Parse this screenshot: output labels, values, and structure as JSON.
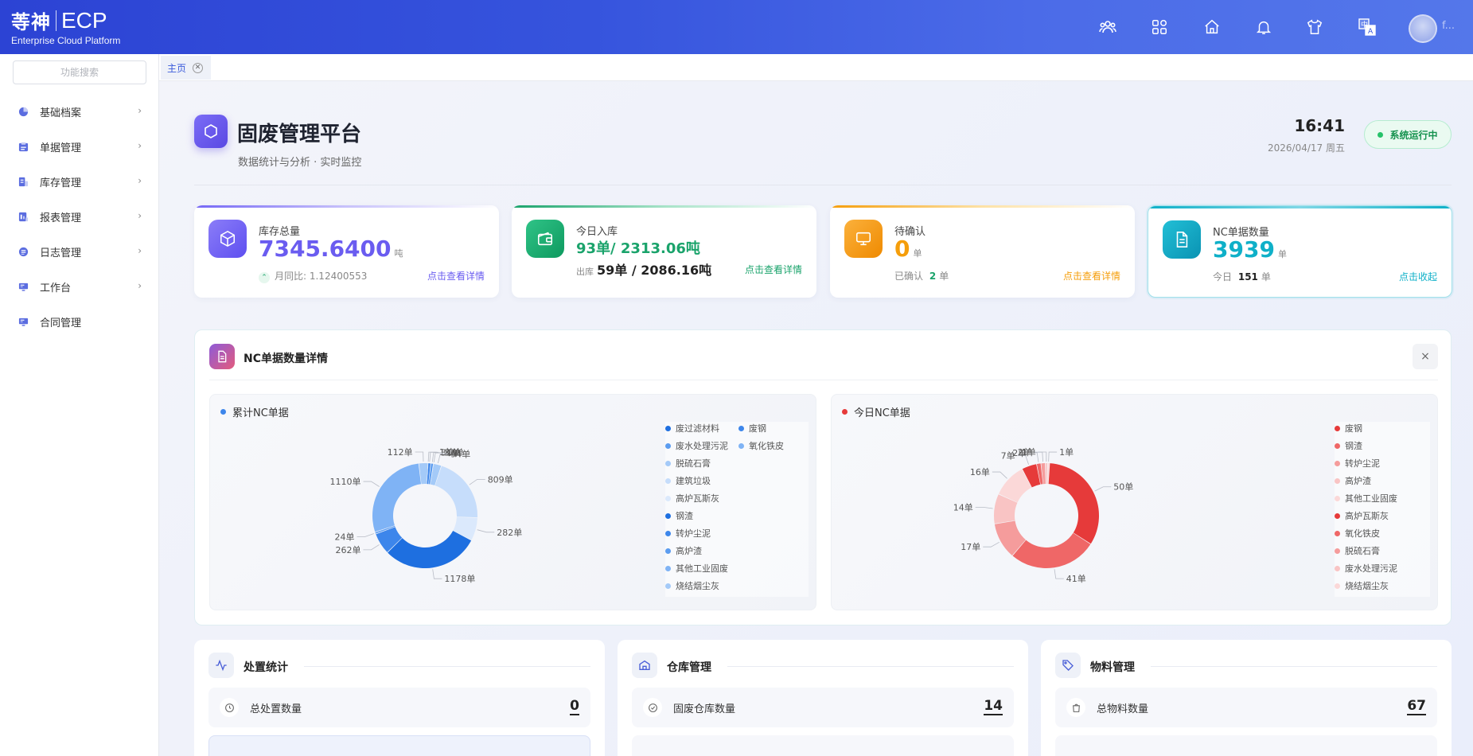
{
  "header": {
    "logo_mark": "䓁神",
    "logo_ecp": "ECP",
    "logo_sub": "Enterprise Cloud Platform",
    "username": "f..."
  },
  "sidebar": {
    "search_placeholder": "功能搜索",
    "items": [
      {
        "label": "基础档案",
        "icon": "pie-chart-icon"
      },
      {
        "label": "单据管理",
        "icon": "clipboard-icon"
      },
      {
        "label": "库存管理",
        "icon": "storage-icon"
      },
      {
        "label": "报表管理",
        "icon": "report-icon"
      },
      {
        "label": "日志管理",
        "icon": "log-icon"
      },
      {
        "label": "工作台",
        "icon": "monitor-icon"
      },
      {
        "label": "合同管理",
        "icon": "monitor-icon"
      }
    ]
  },
  "tabs": [
    {
      "label": "主页"
    }
  ],
  "page": {
    "title": "固废管理平台",
    "subtitle": "数据统计与分析 · 实时监控",
    "time": "16:41",
    "date": "2026/04/17 周五",
    "status": "系统运行中"
  },
  "kpis": [
    {
      "label": "库存总量",
      "value": "7345.6400",
      "unit": "吨",
      "sub": "月同比: 1.12400553",
      "link": "点击查看详情",
      "color": "#6a5cf0"
    },
    {
      "label": "今日入库",
      "value": "93单/ 2313.06吨",
      "sub_label": "出库",
      "sub_value": "59单 / 2086.16吨",
      "link": "点击查看详情",
      "color": "#1aa36b"
    },
    {
      "label": "待确认",
      "value": "0",
      "unit": "单",
      "sub_label": "已确认",
      "sub_value": "2",
      "sub_unit": "单",
      "link": "点击查看详情",
      "color": "#f59e0b"
    },
    {
      "label": "NC单据数量",
      "value": "3939",
      "unit": "单",
      "sub_label": "今日",
      "sub_value": "151",
      "sub_unit": "单",
      "link": "点击收起",
      "color": "#0fb0c8"
    }
  ],
  "nc_panel": {
    "title": "NC单据数量详情",
    "close": "×"
  },
  "chart_data": [
    {
      "type": "pie",
      "title": "累计NC单据",
      "legend": [
        "废过滤材料",
        "废钢",
        "废水处理污泥",
        "氧化铁皮",
        "脱硫石膏",
        "建筑垃圾",
        "高炉瓦斯灰",
        "钢渣",
        "转炉尘泥",
        "高炉渣",
        "其他工业固废",
        "烧结烟尘灰"
      ],
      "slices": [
        {
          "label": "1单",
          "value": 1
        },
        {
          "label": "31单",
          "value": 31
        },
        {
          "label": "32单",
          "value": 32
        },
        {
          "label": "4单",
          "value": 4
        },
        {
          "label": "94单",
          "value": 94
        },
        {
          "label": "809单",
          "value": 809
        },
        {
          "label": "282单",
          "value": 282
        },
        {
          "label": "1178单",
          "value": 1178
        },
        {
          "label": "262单",
          "value": 262
        },
        {
          "label": "24单",
          "value": 24
        },
        {
          "label": "1110单",
          "value": 1110
        },
        {
          "label": "112单",
          "value": 112
        }
      ],
      "colors": [
        "#1e6fe0",
        "#3d86eb",
        "#5b9cf0",
        "#7fb3f5",
        "#a4caf8",
        "#c6ddfb",
        "#dbe9fc"
      ]
    },
    {
      "type": "pie",
      "title": "今日NC单据",
      "legend": [
        "废钢",
        "钢渣",
        "转炉尘泥",
        "高炉渣",
        "其他工业固废",
        "高炉瓦斯灰",
        "氧化铁皮",
        "脱硫石膏",
        "废水处理污泥",
        "烧结烟尘灰"
      ],
      "slices": [
        {
          "label": "50单",
          "value": 50
        },
        {
          "label": "41单",
          "value": 41
        },
        {
          "label": "17单",
          "value": 17
        },
        {
          "label": "14单",
          "value": 14
        },
        {
          "label": "16单",
          "value": 16
        },
        {
          "label": "7单",
          "value": 7
        },
        {
          "label": "2单",
          "value": 2
        },
        {
          "label": "2单",
          "value": 2
        },
        {
          "label": "1单",
          "value": 1
        },
        {
          "label": "1单",
          "value": 1
        }
      ],
      "colors": [
        "#e63a3a",
        "#ef6767",
        "#f59c9c",
        "#f9c4c4",
        "#fbd8d8"
      ]
    }
  ],
  "bottom_cards": [
    {
      "title": "处置统计",
      "row_label": "总处置数量",
      "row_value": "0"
    },
    {
      "title": "仓库管理",
      "row_label": "固废仓库数量",
      "row_value": "14"
    },
    {
      "title": "物料管理",
      "row_label": "总物料数量",
      "row_value": "67"
    }
  ]
}
